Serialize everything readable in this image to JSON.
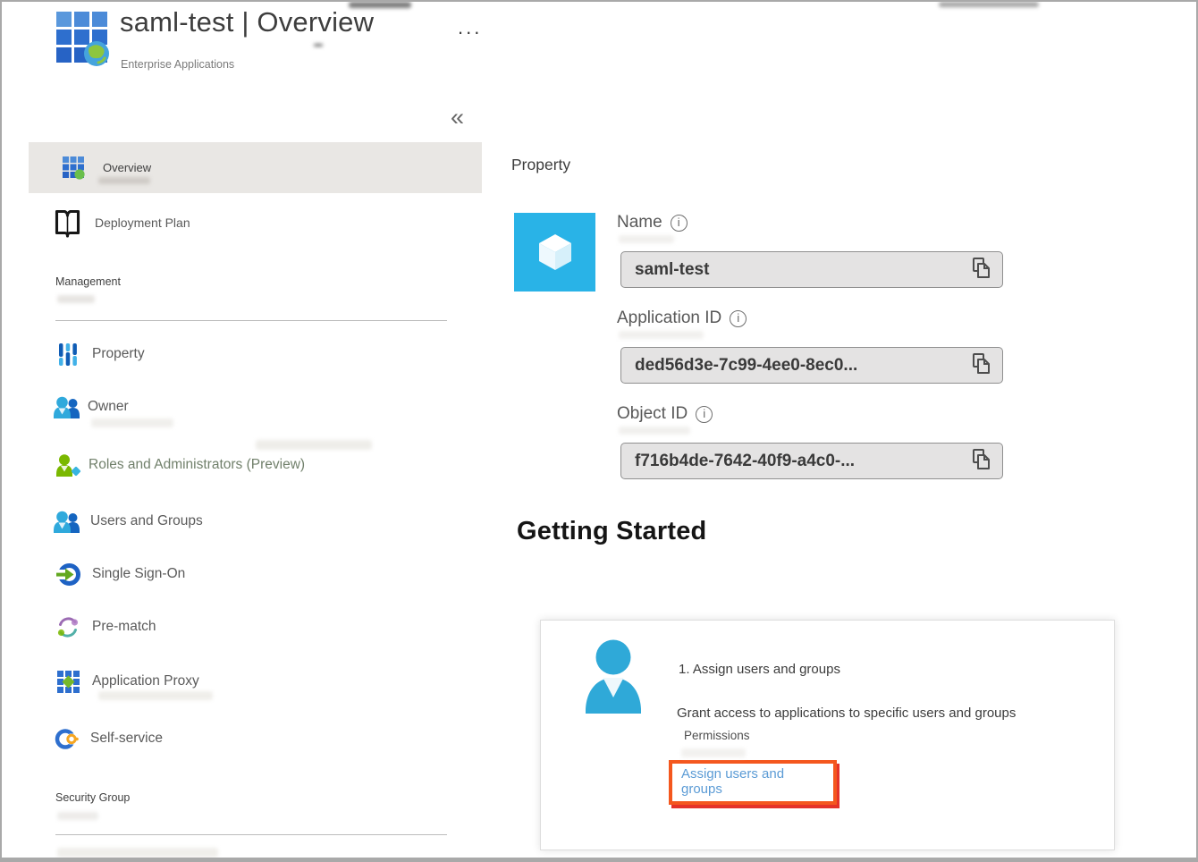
{
  "window": {
    "title": "saml-test | Overview",
    "subtitle": "Enterprise Applications",
    "more_options": "...",
    "collapse_glyph": "«"
  },
  "sidebar": {
    "top_items": [
      {
        "label": "Overview",
        "selected": true
      },
      {
        "label": "Deployment Plan",
        "selected": false
      }
    ],
    "sections": [
      {
        "label": "Management",
        "items": [
          {
            "label": "Property"
          },
          {
            "label": "Owner"
          },
          {
            "label": "Roles and Administrators (Preview)"
          },
          {
            "label": "Users and Groups"
          },
          {
            "label": "Single Sign-On"
          },
          {
            "label": "Pre-match"
          },
          {
            "label": "Application Proxy"
          },
          {
            "label": "Self-service"
          }
        ]
      },
      {
        "label": "Security Group",
        "items": []
      }
    ]
  },
  "main": {
    "panel_title": "Property",
    "fields": [
      {
        "label": "Name",
        "value": "saml-test"
      },
      {
        "label": "Application ID",
        "value": "ded56d3e-7c99-4ee0-8ec0..."
      },
      {
        "label": "Object ID",
        "value": "f716b4de-7642-40f9-a4c0-..."
      }
    ],
    "getting_started": {
      "heading": "Getting Started",
      "card": {
        "step_title": "1. Assign users and groups",
        "description": "Grant access to applications to specific users and groups",
        "permissions_label": "Permissions",
        "link_text": "Assign users and groups"
      }
    }
  },
  "colors": {
    "tile_cyan": "#29b3e7",
    "highlight_orange": "#f4571e",
    "highlight_shadow_red": "#e53228",
    "link_blue": "#5b9bd5",
    "selected_row_bg": "#e9e7e4"
  }
}
